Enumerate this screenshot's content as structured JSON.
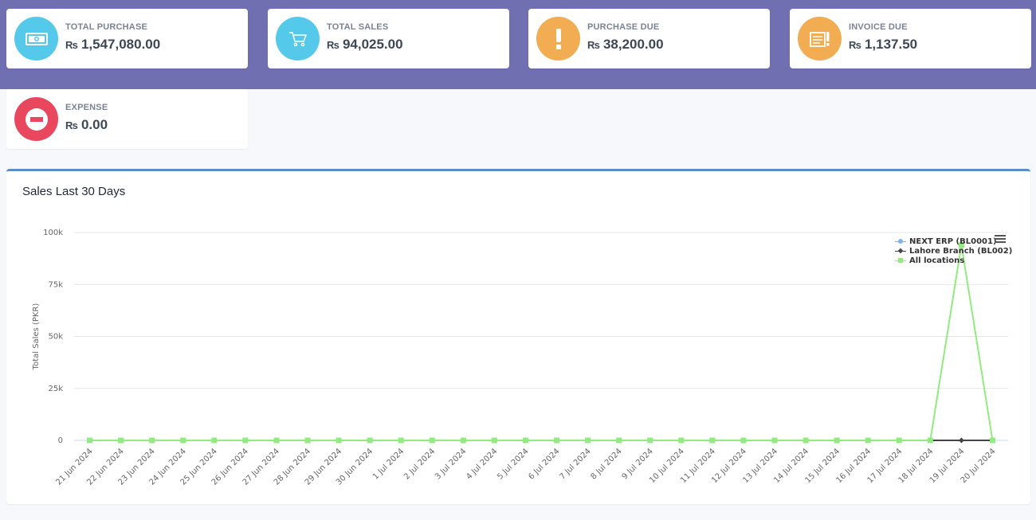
{
  "stats": [
    {
      "label": "TOTAL PURCHASE",
      "currency": "₨",
      "amount": "1,547,080.00",
      "icon": "money-icon",
      "color": "#55c9e9"
    },
    {
      "label": "TOTAL SALES",
      "currency": "₨",
      "amount": "94,025.00",
      "icon": "cart-icon",
      "color": "#55c9e9"
    },
    {
      "label": "PURCHASE DUE",
      "currency": "₨",
      "amount": "38,200.00",
      "icon": "exclamation-icon",
      "color": "#f2ad53"
    },
    {
      "label": "INVOICE DUE",
      "currency": "₨",
      "amount": "1,137.50",
      "icon": "invoice-icon",
      "color": "#f2ad53"
    },
    {
      "label": "EXPENSE",
      "currency": "₨",
      "amount": "0.00",
      "icon": "minus-circle-icon",
      "color": "#e8475d"
    }
  ],
  "chart_panel": {
    "title": "Sales Last 30 Days"
  },
  "chart_data": {
    "type": "line",
    "ylabel": "Total Sales (PKR)",
    "ylim": [
      0,
      100000
    ],
    "y_ticks": [
      0,
      25000,
      50000,
      75000,
      100000
    ],
    "y_tick_labels": [
      "0",
      "25k",
      "50k",
      "75k",
      "100k"
    ],
    "grid": true,
    "legend_position": "top-right",
    "categories": [
      "21 Jun 2024",
      "22 Jun 2024",
      "23 Jun 2024",
      "24 Jun 2024",
      "25 Jun 2024",
      "26 Jun 2024",
      "27 Jun 2024",
      "28 Jun 2024",
      "29 Jun 2024",
      "30 Jun 2024",
      "1 Jul 2024",
      "2 Jul 2024",
      "3 Jul 2024",
      "4 Jul 2024",
      "5 Jul 2024",
      "6 Jul 2024",
      "7 Jul 2024",
      "8 Jul 2024",
      "9 Jul 2024",
      "10 Jul 2024",
      "11 Jul 2024",
      "12 Jul 2024",
      "13 Jul 2024",
      "14 Jul 2024",
      "15 Jul 2024",
      "16 Jul 2024",
      "17 Jul 2024",
      "18 Jul 2024",
      "19 Jul 2024",
      "20 Jul 2024"
    ],
    "series": [
      {
        "name": "NEXT ERP (BL0001)",
        "color": "#7cb5ec",
        "marker": "circle",
        "values": [
          null,
          null,
          null,
          null,
          null,
          null,
          null,
          null,
          null,
          null,
          null,
          null,
          null,
          null,
          null,
          null,
          null,
          null,
          null,
          null,
          null,
          null,
          null,
          null,
          null,
          null,
          null,
          null,
          null,
          null
        ]
      },
      {
        "name": "Lahore Branch (BL002)",
        "color": "#434348",
        "marker": "diamond",
        "values": [
          null,
          null,
          null,
          null,
          null,
          null,
          null,
          null,
          null,
          null,
          null,
          null,
          null,
          null,
          null,
          null,
          null,
          null,
          null,
          null,
          null,
          null,
          null,
          null,
          null,
          null,
          null,
          0,
          0,
          0
        ]
      },
      {
        "name": "All locations",
        "color": "#90ed7d",
        "marker": "square",
        "values": [
          0,
          0,
          0,
          0,
          0,
          0,
          0,
          0,
          0,
          0,
          0,
          0,
          0,
          0,
          0,
          0,
          0,
          0,
          0,
          0,
          0,
          0,
          0,
          0,
          0,
          0,
          0,
          0,
          94025,
          0
        ]
      }
    ]
  }
}
